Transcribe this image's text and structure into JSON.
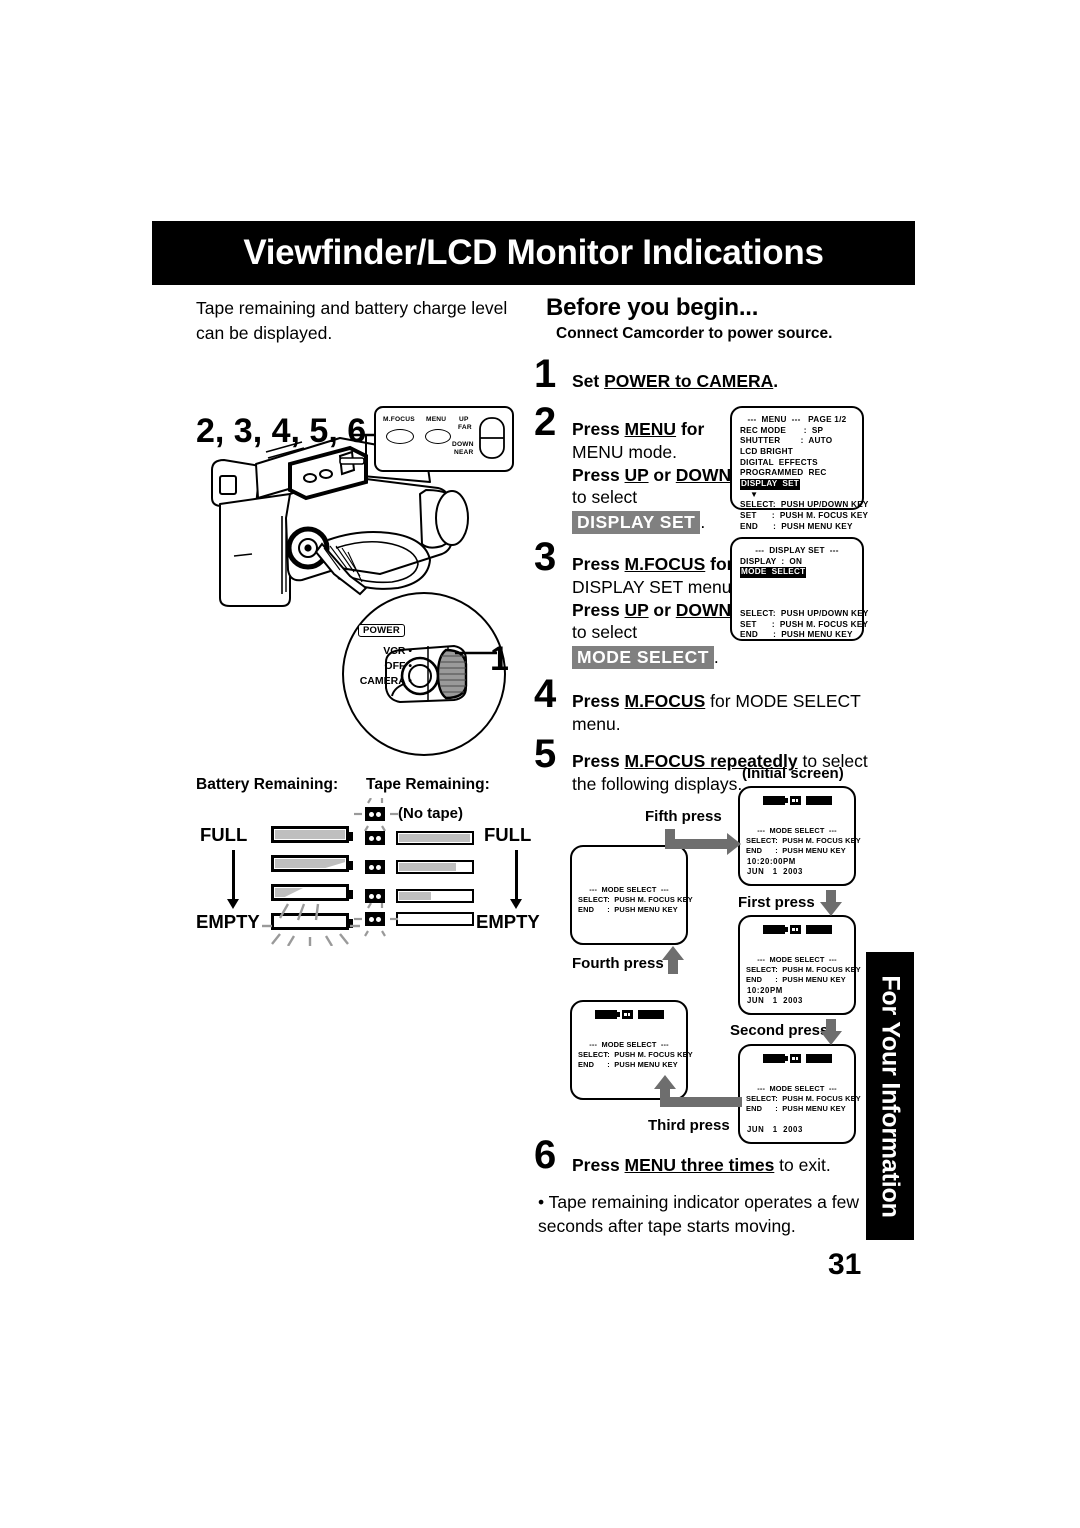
{
  "header": {
    "title": "Viewfinder/LCD Monitor Indications"
  },
  "intro": {
    "text": "Tape remaining and battery charge level can be displayed."
  },
  "before": {
    "heading": "Before you begin...",
    "subtext": "Connect Camcorder to power source."
  },
  "steps": [
    {
      "num": "1",
      "l1_a": "Set ",
      "l1_b": "POWER to CAMERA",
      "l1_c": "."
    },
    {
      "num": "2",
      "l1_a": "Press ",
      "l1_b": "MENU",
      "l1_c": " for",
      "l2": "MENU mode.",
      "l3_a": "Press ",
      "l3_b": "UP",
      "l3_c": " or ",
      "l3_d": "DOWN",
      "l4": "to select",
      "l5_inv": "DISPLAY SET",
      "l5_end": "."
    },
    {
      "num": "3",
      "l1_a": "Press ",
      "l1_b": "M.FOCUS",
      "l1_c": " for",
      "l2": "DISPLAY SET menu.",
      "l3_a": "Press ",
      "l3_b": "UP",
      "l3_c": " or ",
      "l3_d": "DOWN",
      "l4": "to select",
      "l5_inv": "MODE SELECT",
      "l5_end": "."
    },
    {
      "num": "4",
      "l1_a": "Press ",
      "l1_b": "M.FOCUS",
      "l1_c": " for MODE SELECT",
      "l2": "menu."
    },
    {
      "num": "5",
      "l1_a": "Press ",
      "l1_b": "M.FOCUS repeatedly",
      "l1_c": " to select",
      "l2": "the following displays."
    }
  ],
  "step6": {
    "num": "6",
    "a": "Press ",
    "b": "MENU three times",
    "c": " to exit.",
    "note": "• Tape remaining indicator operates a few seconds after tape starts moving."
  },
  "menu_screen": {
    "title": "---  MENU  ---   PAGE 1/2",
    "rows": [
      "REC MODE       :  SP",
      "SHUTTER        :  AUTO",
      "LCD BRIGHT",
      "DIGITAL  EFFECTS",
      "PROGRAMMED  REC"
    ],
    "highlighted": "DISPLAY  SET",
    "caret": "▼",
    "footer": [
      "SELECT:  PUSH UP/DOWN KEY",
      "SET      :  PUSH M. FOCUS KEY",
      "END      :  PUSH MENU KEY"
    ]
  },
  "display_set_screen": {
    "title": "---  DISPLAY SET  ---",
    "rows": [
      "DISPLAY  :  ON"
    ],
    "highlighted": "MODE  SELECT",
    "footer": [
      "SELECT:  PUSH UP/DOWN KEY",
      "SET      :  PUSH M. FOCUS KEY",
      "END      :  PUSH MENU KEY"
    ]
  },
  "camcorder": {
    "callout_numbers": "2, 3, 4, 5, 6",
    "button_box": {
      "mfocus": "M.FOCUS",
      "menu": "MENU",
      "up": "UP",
      "far": "FAR",
      "down": "DOWN",
      "near": "NEAR"
    },
    "power": {
      "tag": "POWER",
      "options": [
        "VCR •",
        "OFF •",
        "CAMERA •"
      ],
      "callout": "1"
    }
  },
  "remaining": {
    "battery_heading": "Battery Remaining:",
    "tape_heading": "Tape Remaining:",
    "full_label": "FULL",
    "empty_label": "EMPTY",
    "no_tape_label": "(No tape)",
    "battery_levels": [
      100,
      75,
      40,
      0
    ],
    "tape_levels": [
      100,
      80,
      45,
      20,
      0
    ]
  },
  "flow": {
    "initial_label": "(Initial screen)",
    "press_labels": {
      "first": "First press",
      "second": "Second press",
      "third": "Third press",
      "fourth": "Fourth press",
      "fifth": "Fifth press"
    },
    "screen_body": [
      "---  MODE SELECT  ---",
      "SELECT:  PUSH M. FOCUS KEY",
      "END      :  PUSH MENU KEY"
    ],
    "screens": {
      "initial": {
        "icons": true,
        "stamp": "10:20:00PM\nJUN   1  2003"
      },
      "first": {
        "icons": true,
        "stamp": "10:20PM\nJUN   1  2003"
      },
      "second": {
        "icons": true,
        "stamp": "JUN   1  2003"
      },
      "third": {
        "icons": true,
        "stamp": ""
      },
      "fourth": {
        "icons": false,
        "stamp": ""
      }
    }
  },
  "sidetab": {
    "label": "For Your Information"
  },
  "page_number": "31"
}
